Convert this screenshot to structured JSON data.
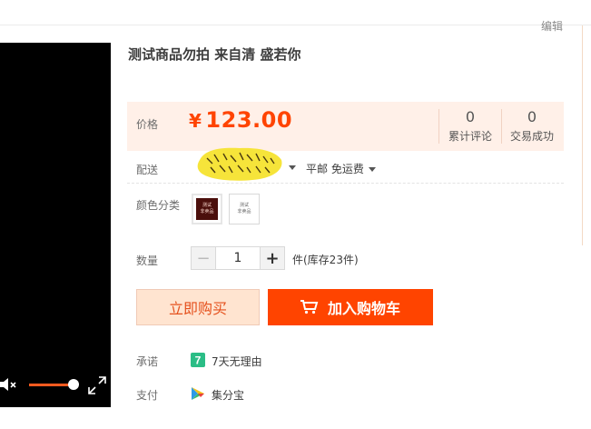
{
  "header": {
    "edit_label": "编辑"
  },
  "product": {
    "title": "测试商品勿拍 来自⁡清 ⁡盛若你"
  },
  "price": {
    "label": "价格",
    "currency": "¥",
    "value": "123.00"
  },
  "stats": [
    {
      "value": "0",
      "label": "累计评论"
    },
    {
      "value": "0",
      "label": "交易成功"
    }
  ],
  "delivery": {
    "label": "配送",
    "shipping": "平邮 免运费"
  },
  "variants": {
    "label": "颜色分类",
    "options": [
      {
        "line1": "测试",
        "line2": "非卖品"
      },
      {
        "line1": "测试",
        "line2": "非卖品"
      }
    ]
  },
  "quantity": {
    "label": "数量",
    "minus": "−",
    "plus": "+",
    "value": "1",
    "stock_text": "件(库存23件)"
  },
  "buttons": {
    "buy_now": "立即购买",
    "add_cart": "加入购物车"
  },
  "promise": {
    "label": "承诺",
    "badge_text": "7",
    "text": "7天无理由"
  },
  "payment": {
    "label": "支付",
    "text": "集分宝"
  },
  "colors": {
    "accent": "#ff4400",
    "price_bg": "#fff0e8",
    "buy_now_bg": "#ffe4d0",
    "promise_green": "#2bbd86"
  }
}
